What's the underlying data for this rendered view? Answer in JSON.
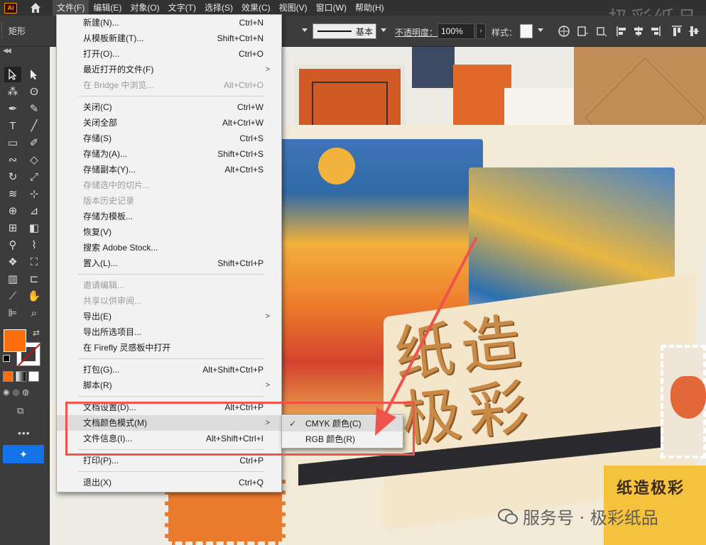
{
  "app": {
    "logo_text": "Ai",
    "menubar": [
      "文件(F)",
      "编辑(E)",
      "对象(O)",
      "文字(T)",
      "选择(S)",
      "效果(C)",
      "视图(V)",
      "窗口(W)",
      "帮助(H)"
    ],
    "watermark_top": "极彩纸品"
  },
  "controlbar": {
    "shape_label": "矩形",
    "stroke_profile": "基本",
    "opacity_label": "不透明度：",
    "opacity_value": "100%",
    "style_label": "样式："
  },
  "file_menu": {
    "items": [
      {
        "label": "新建(N)...",
        "shortcut": "Ctrl+N"
      },
      {
        "label": "从模板新建(T)...",
        "shortcut": "Shift+Ctrl+N"
      },
      {
        "label": "打开(O)...",
        "shortcut": "Ctrl+O"
      },
      {
        "label": "最近打开的文件(F)",
        "shortcut": ""
      },
      {
        "label": "在 Bridge 中浏览...",
        "shortcut": "Alt+Ctrl+O"
      },
      {
        "label": "关闭(C)",
        "shortcut": "Ctrl+W"
      },
      {
        "label": "关闭全部",
        "shortcut": "Alt+Ctrl+W"
      },
      {
        "label": "存储(S)",
        "shortcut": "Ctrl+S"
      },
      {
        "label": "存储为(A)...",
        "shortcut": "Shift+Ctrl+S"
      },
      {
        "label": "存储副本(Y)...",
        "shortcut": "Alt+Ctrl+S"
      },
      {
        "label": "存储选中的切片...",
        "shortcut": ""
      },
      {
        "label": "版本历史记录",
        "shortcut": ""
      },
      {
        "label": "存储为模板...",
        "shortcut": ""
      },
      {
        "label": "恢复(V)",
        "shortcut": ""
      },
      {
        "label": "搜索 Adobe Stock...",
        "shortcut": ""
      },
      {
        "label": "置入(L)...",
        "shortcut": "Shift+Ctrl+P"
      },
      {
        "label": "邀请编辑...",
        "shortcut": ""
      },
      {
        "label": "共享以供审阅...",
        "shortcut": ""
      },
      {
        "label": "导出(E)",
        "shortcut": ""
      },
      {
        "label": "导出所选项目...",
        "shortcut": ""
      },
      {
        "label": "在 Firefly 灵感板中打开",
        "shortcut": ""
      },
      {
        "label": "打包(G)...",
        "shortcut": "Alt+Shift+Ctrl+P"
      },
      {
        "label": "脚本(R)",
        "shortcut": ""
      },
      {
        "label": "文档设置(D)...",
        "shortcut": "Alt+Ctrl+P"
      },
      {
        "label": "文档颜色模式(M)",
        "shortcut": ""
      },
      {
        "label": "文件信息(I)...",
        "shortcut": "Alt+Shift+Ctrl+I"
      },
      {
        "label": "打印(P)...",
        "shortcut": "Ctrl+P"
      },
      {
        "label": "退出(X)",
        "shortcut": "Ctrl+Q"
      }
    ]
  },
  "color_mode_submenu": {
    "items": [
      {
        "label": "CMYK 颜色(C)",
        "checked": true
      },
      {
        "label": "RGB 颜色(R)",
        "checked": false
      }
    ]
  },
  "artwork": {
    "big_text_line1": "纸造",
    "big_text_line2": "极彩",
    "card_text": "纸造极彩",
    "watermark_bottom": "服务号 · 极彩纸品"
  },
  "colors": {
    "fill": "#ff6e0d",
    "highlight": "#f0524c",
    "accent": "#1473e6"
  }
}
